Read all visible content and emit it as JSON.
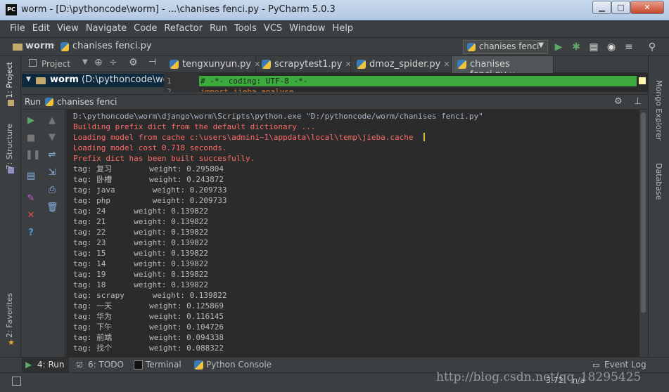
{
  "window": {
    "title": "worm - [D:\\pythoncode\\worm] - ...\\chanises fenci.py - PyCharm 5.0.3",
    "app_icon": "PC",
    "minimize": "▁",
    "maximize": "□",
    "close": "✕"
  },
  "menu": [
    "File",
    "Edit",
    "View",
    "Navigate",
    "Code",
    "Refactor",
    "Run",
    "Tools",
    "VCS",
    "Window",
    "Help"
  ],
  "nav": {
    "project": "worm",
    "file": "chanises fenci.py",
    "run_config": "chanises fenci"
  },
  "project_panel": {
    "title": "Project",
    "root": "worm",
    "root_path": " (D:\\pythoncode\\worm)"
  },
  "editor_tabs": [
    {
      "label": "tengxunyun.py",
      "active": false
    },
    {
      "label": "scrapytest1.py",
      "active": false
    },
    {
      "label": "dmoz_spider.py",
      "active": false
    },
    {
      "label": "chanises fenci.py",
      "active": true
    }
  ],
  "editor": {
    "line_numbers": [
      "1",
      "2"
    ],
    "lines": [
      "# -*- coding: UTF-8 -*-",
      "import jieba.analyse"
    ]
  },
  "run_panel": {
    "label": "Run",
    "config": "chanises fenci"
  },
  "console": {
    "command": "D:\\pythoncode\\worm\\django\\worm\\Scripts\\python.exe \"D:/pythoncode/worm/chanises fenci.py\"",
    "log": [
      "Building prefix dict from the default dictionary ...",
      "Loading model from cache c:\\users\\admini~1\\appdata\\local\\temp\\jieba.cache",
      "Loading model cost 0.718 seconds.",
      "Prefix dict has been built succesfully."
    ],
    "output": [
      "tag: 复习        weight: 0.295804",
      "tag: 卧槽        weight: 0.243872",
      "tag: java        weight: 0.209733",
      "tag: php         weight: 0.209733",
      "tag: 24      weight: 0.139822",
      "tag: 21      weight: 0.139822",
      "tag: 22      weight: 0.139822",
      "tag: 23      weight: 0.139822",
      "tag: 15      weight: 0.139822",
      "tag: 14      weight: 0.139822",
      "tag: 19      weight: 0.139822",
      "tag: 18      weight: 0.139822",
      "tag: scrapy      weight: 0.139822",
      "tag: 一天        weight: 0.125869",
      "tag: 华为        weight: 0.116145",
      "tag: 下午        weight: 0.104726",
      "tag: 前端        weight: 0.094338",
      "tag: 找个        weight: 0.088322"
    ]
  },
  "left_tabs": [
    "1: Project",
    "7: Structure",
    "2: Favorites"
  ],
  "right_tabs": [
    "Mongo Explorer",
    "Database"
  ],
  "bottom_tabs": [
    {
      "label": "4: Run",
      "icon": "run-icon",
      "active": true
    },
    {
      "label": "6: TODO",
      "icon": "todo-icon",
      "active": false
    },
    {
      "label": "Terminal",
      "icon": "terminal-icon",
      "active": false
    },
    {
      "label": "Python Console",
      "icon": "python-console-icon",
      "active": false
    },
    {
      "label": "Event Log",
      "icon": "event-log-icon",
      "active": false
    }
  ],
  "status": {
    "position": "3:72",
    "line_sep": "n/a"
  },
  "watermark": "http://blog.csdn.net/qq_18295425",
  "colors": {
    "accent_green": "#3daa3d",
    "error_red": "#ff6b68",
    "console_bg": "#2b2b2b"
  }
}
